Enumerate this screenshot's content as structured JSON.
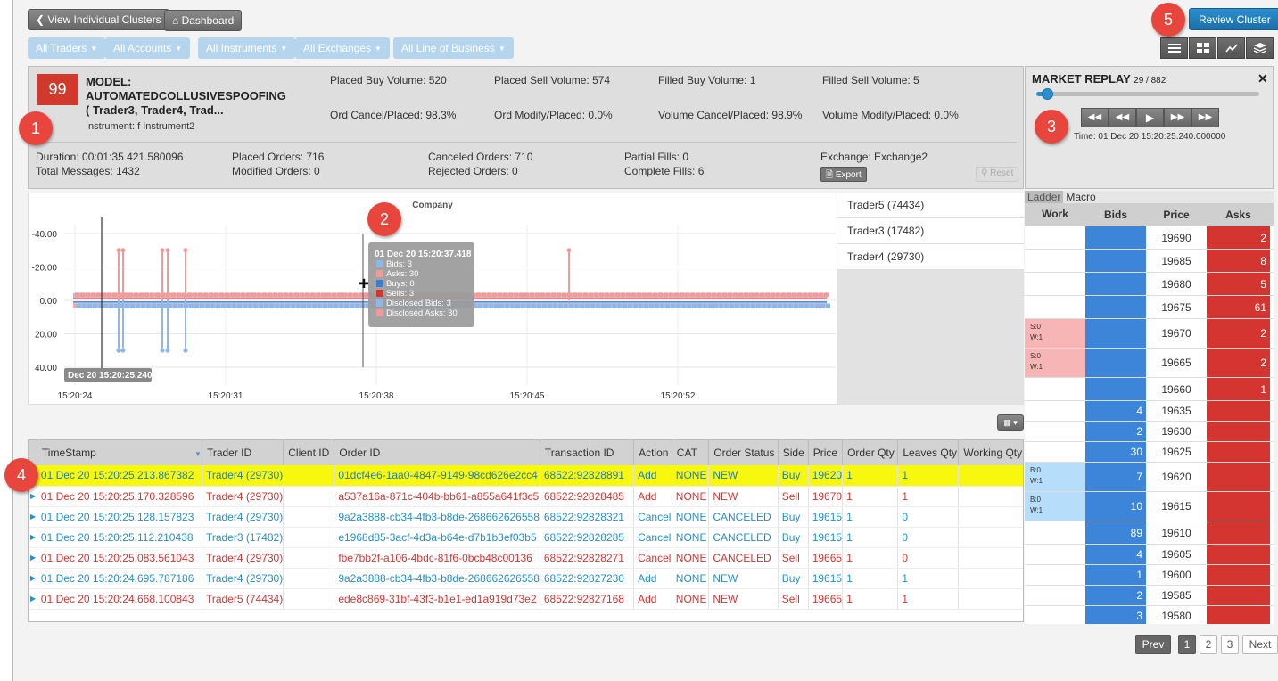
{
  "top": {
    "view_clusters_label": "View Individual Clusters",
    "dashboard_label": "Dashboard",
    "review_cluster_label": "Review Cluster"
  },
  "filters": [
    "All Traders",
    "All Accounts",
    "All Instruments",
    "All Exchanges",
    "All Line of Business"
  ],
  "badges": [
    "1",
    "2",
    "3",
    "4",
    "5"
  ],
  "model": {
    "score": "99",
    "title_line1": "MODEL:",
    "title_line2": "AUTOMATEDCOLLUSIVESPOOFING",
    "title_line3": "( Trader3, Trader4, Trad...",
    "instrument": "Instrument: f Instrument2",
    "placed_buy": "Placed Buy Volume: 520",
    "placed_sell": "Placed Sell Volume: 574",
    "filled_buy": "Filled Buy Volume: 1",
    "filled_sell": "Filled Sell Volume: 5",
    "ord_cancel": "Ord Cancel/Placed: 98.3%",
    "ord_modify": "Ord Modify/Placed: 0.0%",
    "vol_cancel": "Volume Cancel/Placed: 98.9%",
    "vol_modify": "Volume Modify/Placed: 0.0%",
    "duration": "Duration: 00:01:35 421.580096",
    "total_messages": "Total Messages: 1432",
    "placed_orders": "Placed Orders: 716",
    "modified_orders": "Modified Orders: 0",
    "canceled_orders": "Canceled Orders: 710",
    "rejected_orders": "Rejected Orders: 0",
    "partial_fills": "Partial Fills: 0",
    "complete_fills": "Complete Fills: 6",
    "exchange": "Exchange: Exchange2",
    "export_label": "Export",
    "reset_label": "Reset"
  },
  "chart": {
    "title": "Company",
    "y_ticks": [
      "-40.00",
      "-20.00",
      "0.00",
      "20.00",
      "40.00"
    ],
    "x_ticks": [
      "15:20:24",
      "15:20:31",
      "15:20:38",
      "15:20:45",
      "15:20:52"
    ],
    "cursor_label": "Dec 20 15:20:25.240",
    "tooltip": {
      "title": "01 Dec 20 15:20:37.418",
      "lines": [
        "Bids: 3",
        "Asks: 30",
        "Buys: 0",
        "Sells: 3",
        "Disclosed Bids: 3",
        "Disclosed Asks: 30"
      ],
      "colors": [
        "#8fb8e8",
        "#f09a9a",
        "#3c7fd0",
        "#d43531",
        "#8fb8e8",
        "#f09a9a"
      ]
    },
    "colors": {
      "bids": "#8fb8e8",
      "asks": "#f09a9a",
      "buys": "#3c7fd0",
      "sells": "#d43531"
    }
  },
  "chart_data": {
    "type": "line",
    "title": "Company",
    "xlabel": "",
    "ylabel": "",
    "ylim": [
      40,
      -40
    ],
    "x_categories": [
      "15:20:24",
      "15:20:31",
      "15:20:38",
      "15:20:45",
      "15:20:52"
    ],
    "series": [
      {
        "name": "Bids",
        "values": [
          3,
          3,
          3,
          3,
          3
        ]
      },
      {
        "name": "Asks",
        "values": [
          -3,
          -3,
          -3,
          -3,
          -3
        ]
      }
    ]
  },
  "legend_traders": [
    "Trader5 (74434)",
    "Trader3 (17482)",
    "Trader4 (29730)"
  ],
  "replay": {
    "title": "MARKET REPLAY",
    "position": "29 / 882",
    "time": "Time: 01 Dec 20 15:20:25.240.000000",
    "progress": 0.033
  },
  "ladder": {
    "tabs": [
      "Ladder",
      "Macro"
    ],
    "headers": [
      "Work",
      "Bids",
      "Price",
      "Asks"
    ],
    "rows": [
      {
        "work": "",
        "bids": "",
        "price": "19690",
        "asks": "2"
      },
      {
        "work": "",
        "bids": "",
        "price": "19685",
        "asks": "8"
      },
      {
        "work": "",
        "bids": "",
        "price": "19680",
        "asks": "5"
      },
      {
        "work": "",
        "bids": "",
        "price": "19675",
        "asks": "61"
      },
      {
        "work": "S:0",
        "work2": "W:1",
        "bids": "",
        "price": "19670",
        "asks": "2"
      },
      {
        "work": "S:0",
        "work2": "W:1",
        "bids": "",
        "price": "19665",
        "asks": "2"
      },
      {
        "work": "",
        "bids": "",
        "price": "19660",
        "asks": "1"
      },
      {
        "work": "",
        "bids": "4",
        "price": "19635",
        "asks": ""
      },
      {
        "work": "",
        "bids": "2",
        "price": "19630",
        "asks": ""
      },
      {
        "work": "",
        "bids": "30",
        "price": "19625",
        "asks": ""
      },
      {
        "work": "B:0",
        "work2": "W:1",
        "bids": "7",
        "price": "19620",
        "asks": ""
      },
      {
        "work": "B:0",
        "work2": "W:1",
        "bids": "10",
        "price": "19615",
        "asks": ""
      },
      {
        "work": "",
        "bids": "89",
        "price": "19610",
        "asks": ""
      },
      {
        "work": "",
        "bids": "4",
        "price": "19605",
        "asks": ""
      },
      {
        "work": "",
        "bids": "1",
        "price": "19600",
        "asks": ""
      },
      {
        "work": "",
        "bids": "2",
        "price": "19585",
        "asks": ""
      },
      {
        "work": "",
        "bids": "3",
        "price": "19580",
        "asks": ""
      }
    ]
  },
  "table": {
    "headers": [
      "TimeStamp",
      "Trader ID",
      "Client ID",
      "Order ID",
      "Transaction ID",
      "Action",
      "CAT",
      "Order Status",
      "Side",
      "Price",
      "Order Qty",
      "Leaves Qty",
      "Working Qty"
    ],
    "rows": [
      [
        "01 Dec 20 15:20:25.213.867382",
        "Trader4 (29730)",
        "",
        "01dcf4e6-1aa0-4847-9149-98cd626e2cc4",
        "68522:92828891",
        "Add",
        "NONE",
        "NEW",
        "Buy",
        "19620",
        "1",
        "1",
        ""
      ],
      [
        "01 Dec 20 15:20:25.170.328596",
        "Trader4 (29730)",
        "",
        "a537a16a-871c-404b-bb61-a855a641f3c5",
        "68522:92828485",
        "Add",
        "NONE",
        "NEW",
        "Sell",
        "19670",
        "1",
        "1",
        ""
      ],
      [
        "01 Dec 20 15:20:25.128.157823",
        "Trader4 (29730)",
        "",
        "9a2a3888-cb34-4fb3-b8de-268662626558",
        "68522:92828321",
        "Cancel",
        "NONE",
        "CANCELED",
        "Buy",
        "19615",
        "1",
        "0",
        ""
      ],
      [
        "01 Dec 20 15:20:25.112.210438",
        "Trader3 (17482)",
        "",
        "e1968d85-3acf-4d3a-b64e-d7b1b3ef03b5",
        "68522:92828285",
        "Cancel",
        "NONE",
        "CANCELED",
        "Buy",
        "19615",
        "1",
        "0",
        ""
      ],
      [
        "01 Dec 20 15:20:25.083.561043",
        "Trader4 (29730)",
        "",
        "fbe7bb2f-a106-4bdc-81f6-0bcb48c00136",
        "68522:92828271",
        "Cancel",
        "NONE",
        "CANCELED",
        "Sell",
        "19665",
        "1",
        "0",
        ""
      ],
      [
        "01 Dec 20 15:20:24.695.787186",
        "Trader4 (29730)",
        "",
        "9a2a3888-cb34-4fb3-b8de-268662626558",
        "68522:92827230",
        "Add",
        "NONE",
        "NEW",
        "Buy",
        "19615",
        "1",
        "1",
        ""
      ],
      [
        "01 Dec 20 15:20:24.668.100843",
        "Trader5 (74434)",
        "",
        "ede8c869-31bf-43f3-b1e1-ed1a919d73e2",
        "68522:92827168",
        "Add",
        "NONE",
        "NEW",
        "Sell",
        "19665",
        "1",
        "1",
        ""
      ]
    ]
  },
  "pager": {
    "prev": "Prev",
    "pages": [
      "1",
      "2",
      "3"
    ],
    "next": "Next"
  }
}
